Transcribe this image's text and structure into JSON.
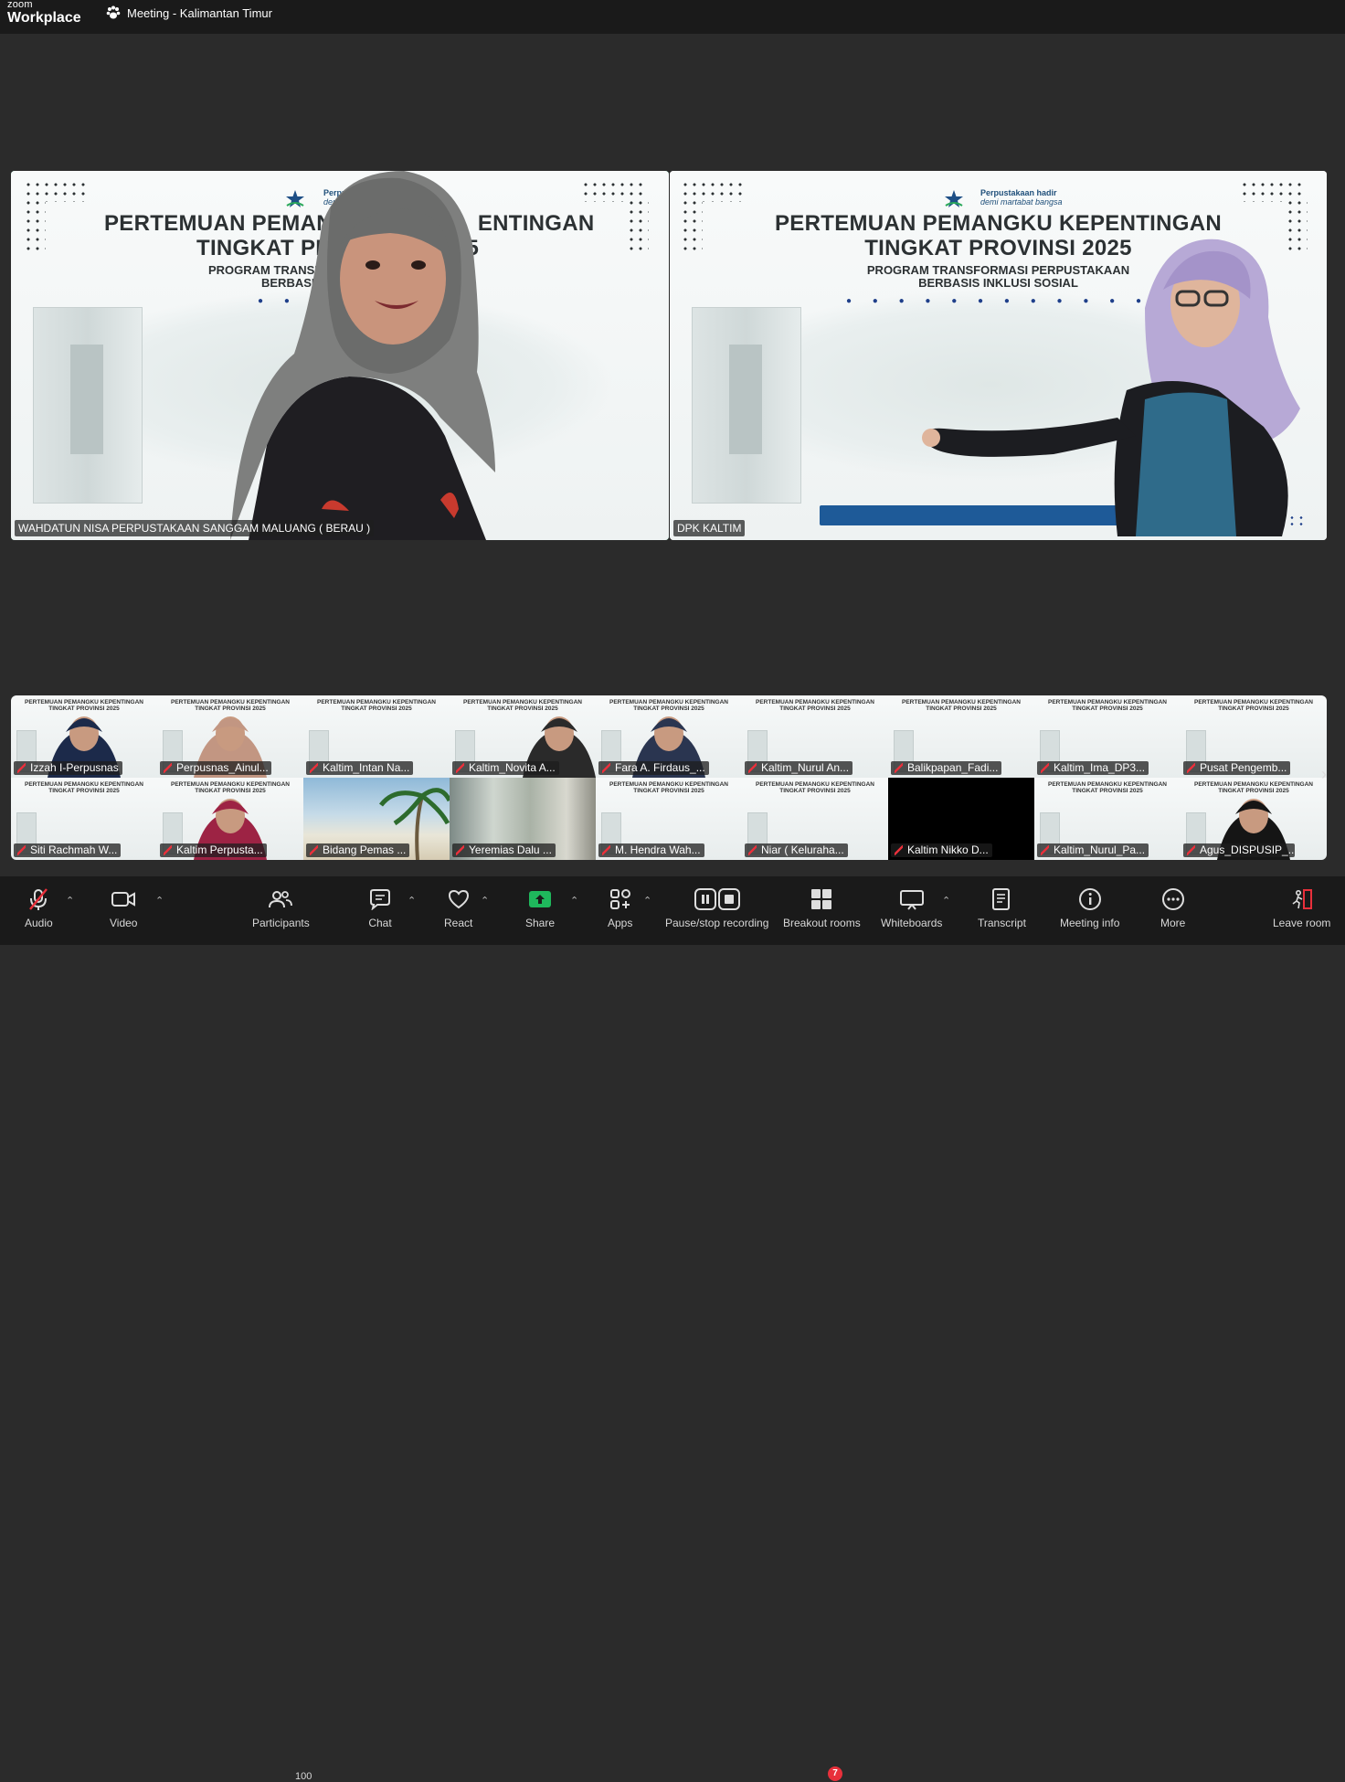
{
  "app": {
    "brand_small": "zoom",
    "brand_main": "Workplace",
    "meeting_title": "Meeting - Kalimantan Timur"
  },
  "slide": {
    "title_line1": "PERTEMUAN PEMANGKU KEPENTINGAN",
    "title_line2": "TINGKAT PROVINSI 2025",
    "sub_line1": "PROGRAM TRANSFORMASI PERPUSTAKAAN",
    "sub_line2": "BERBASIS INKLUSI SOSIAL",
    "logo_line1": "Perpustakaan hadir",
    "logo_line2": "demi martabat bangsa",
    "dots": "● ● ● ● ● ● ● ● ● ● ● ●",
    "left_title_line1": "PERTEMUAN PEMANG",
    "left_title_line1b": "ENTINGAN",
    "left_title_line2": "TINGKAT PR",
    "left_title_line2b": "25",
    "left_sub_line1": "PROGRAM TRANSFO",
    "left_sub_line2": "BERBASIS I",
    "left_logo_line1": "Perpustakaa",
    "left_logo_line2": "demi marta",
    "left_dots": "● ● ● ● ● ●"
  },
  "main_tiles": [
    {
      "name": "WAHDATUN NISA PERPUSTAKAAN SANGGAM MALUANG ( BERAU )"
    },
    {
      "name": "DPK KALTIM"
    }
  ],
  "gallery": {
    "row1": [
      "Izzah I-Perpusnas",
      "Perpusnas_Ainul...",
      "Kaltim_Intan Na...",
      "Kaltim_Novita A...",
      "Fara A. Firdaus_...",
      "Kaltim_Nurul An...",
      "Balikpapan_Fadi...",
      "Kaltim_Ima_DP3...",
      "Pusat Pengemb..."
    ],
    "row2": [
      "Siti Rachmah W...",
      "Kaltim Perpusta...",
      "Bidang Pemas ...",
      "Yeremias Dalu ...",
      "M. Hendra Wah...",
      "Niar ( Keluraha...",
      "Kaltim Nikko D...",
      "Kaltim_Nurul_Pa...",
      "Agus_DISPUSIP_..."
    ]
  },
  "toolbar": {
    "audio": "Audio",
    "video": "Video",
    "participants": "Participants",
    "participants_count": "100",
    "chat": "Chat",
    "react": "React",
    "share": "Share",
    "apps": "Apps",
    "recording": "Pause/stop recording",
    "breakout": "Breakout rooms",
    "breakout_badge": "7",
    "whiteboards": "Whiteboards",
    "transcript": "Transcript",
    "meeting_info": "Meeting info",
    "more": "More",
    "leave": "Leave room"
  },
  "colors": {
    "active_speaker": "#2fd68a",
    "toolbar_bg": "#1a1a1a",
    "stage_bg": "#2b2b2b",
    "share_green": "#1fb85c",
    "muted_red": "#e8303b"
  }
}
